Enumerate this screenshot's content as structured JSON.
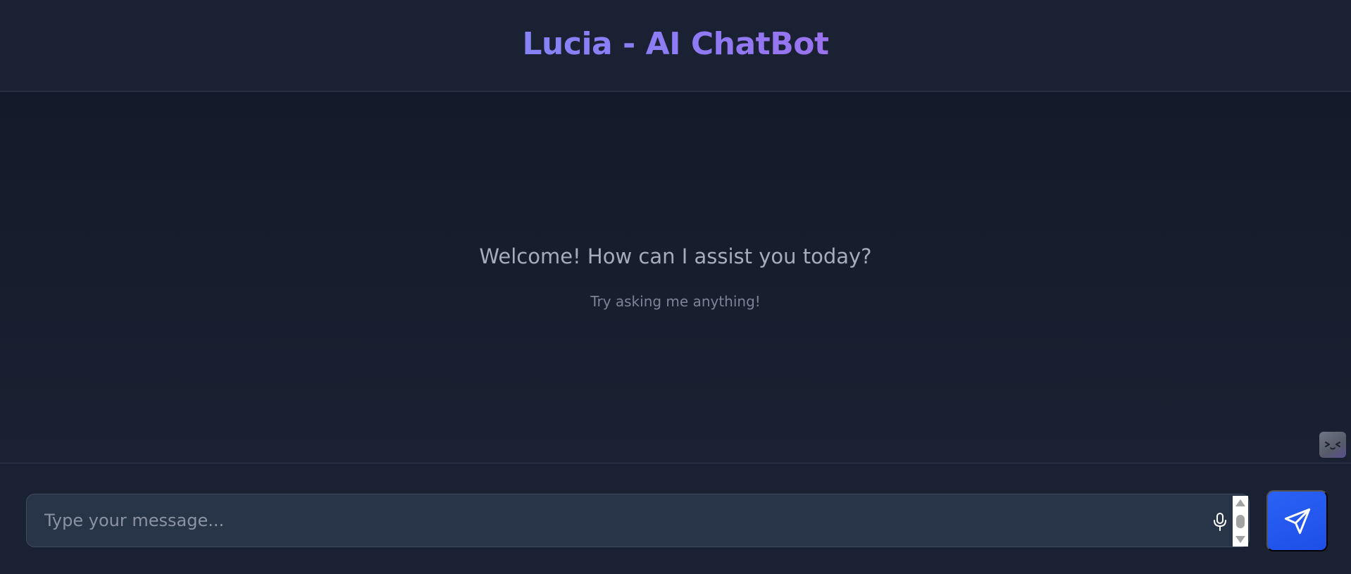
{
  "header": {
    "title": "Lucia - AI ChatBot"
  },
  "chat": {
    "welcome": "Welcome! How can I assist you today?",
    "hint": "Try asking me anything!"
  },
  "composer": {
    "placeholder": "Type your message...",
    "value": ""
  },
  "icons": {
    "mascot": "mascot-face-icon",
    "microphone": "microphone-icon",
    "send": "send-icon"
  },
  "colors": {
    "accent": "#8b7cf6",
    "send_button": "#1e4fe8",
    "background": "#171e2e"
  }
}
